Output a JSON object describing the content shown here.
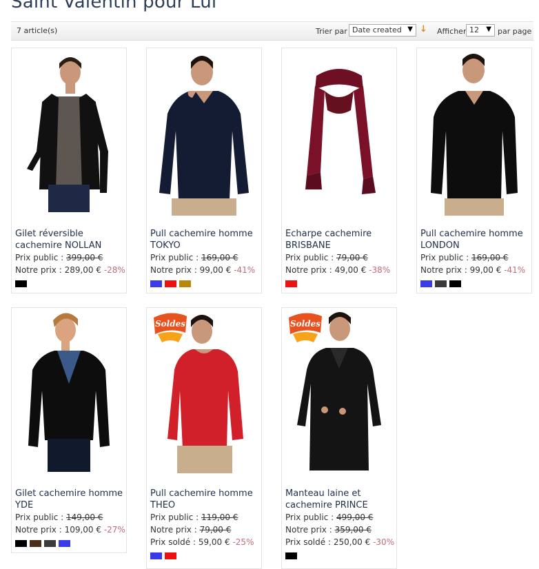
{
  "page": {
    "title": "Saint Valentin pour Lui"
  },
  "toolbar": {
    "count": "7 article(s)",
    "sort_label": "Trier par",
    "sort_value": "Date created",
    "show_label": "Afficher",
    "show_value": "12",
    "per_page_label": "par page"
  },
  "products": [
    {
      "name": "Gilet réversible cachemire NOLLAN",
      "public_label": "Prix public :",
      "public_price": "399,00 €",
      "our_label": "Notre prix :",
      "our_price": "289,00 €",
      "discount": "-28%",
      "swatches": [
        "#000000"
      ]
    },
    {
      "name": "Pull cachemire homme TOKYO",
      "public_label": "Prix public :",
      "public_price": "169,00 €",
      "our_label": "Notre prix :",
      "our_price": "99,00 €",
      "discount": "-41%",
      "swatches": [
        "#3a3ae8",
        "#ee1111",
        "#b8860b"
      ]
    },
    {
      "name": "Echarpe cachemire BRISBANE",
      "public_label": "Prix public :",
      "public_price": "79,00 €",
      "our_label": "Notre prix :",
      "our_price": "49,00 €",
      "discount": "-38%",
      "swatches": [
        "#ee1111"
      ]
    },
    {
      "name": "Pull cachemire homme LONDON",
      "public_label": "Prix public :",
      "public_price": "169,00 €",
      "our_label": "Notre prix :",
      "our_price": "99,00 €",
      "discount": "-41%",
      "swatches": [
        "#3a3ae8",
        "#3a3a3a",
        "#000000"
      ]
    },
    {
      "name": "Gilet cachemire homme YDE",
      "public_label": "Prix public :",
      "public_price": "149,00 €",
      "our_label": "Notre prix :",
      "our_price": "109,00 €",
      "discount": "-27%",
      "swatches": [
        "#000000",
        "#4a2e1a",
        "#3a3a3a",
        "#3a3ae8"
      ]
    },
    {
      "name": "Pull cachemire homme THEO",
      "badge": "Soldes",
      "public_label": "Prix public :",
      "public_price": "119,00 €",
      "our_label": "Notre prix :",
      "our_price": "79,00 €",
      "sale_label": "Prix soldé :",
      "sale_price": "59,00 €",
      "discount": "-25%",
      "swatches": [
        "#3a3ae8",
        "#ee1111"
      ]
    },
    {
      "name": "Manteau laine et cachemire PRINCE",
      "badge": "Soldes",
      "public_label": "Prix public :",
      "public_price": "499,00 €",
      "our_label": "Notre prix :",
      "our_price": "359,00 €",
      "sale_label": "Prix soldé :",
      "sale_price": "250,00 €",
      "discount": "-30%",
      "swatches": [
        "#000000"
      ]
    }
  ]
}
